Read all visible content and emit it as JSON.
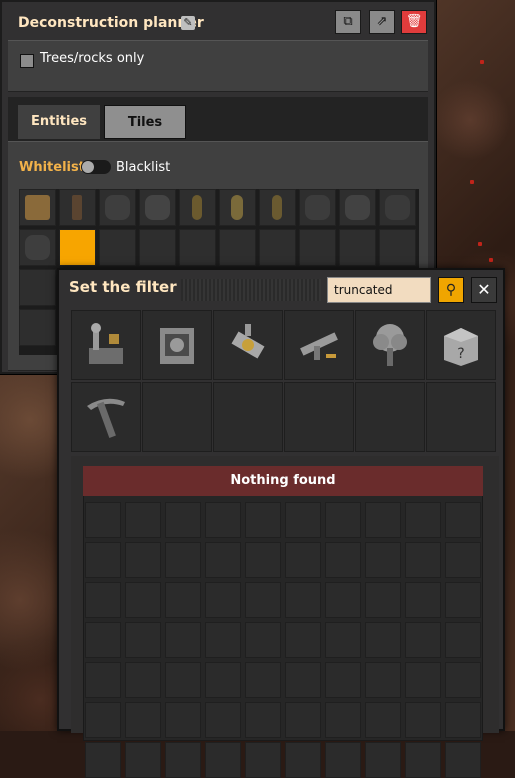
{
  "planner": {
    "title": "Deconstruction planner",
    "icons": {
      "rename": "pencil-icon",
      "copy": "copy-icon",
      "export": "export-icon",
      "delete": "trash-icon"
    },
    "trees_rocks_label": "Trees/rocks only",
    "tabs": [
      {
        "label": "Entities",
        "active": true
      },
      {
        "label": "Tiles",
        "active": false
      }
    ],
    "whitelist_label": "Whitelist",
    "blacklist_label": "Blacklist"
  },
  "filter_dialog": {
    "title": "Set the filter",
    "search_value": "truncated",
    "search_icon": "magnifier-icon",
    "close_icon": "close-icon",
    "groups": [
      "logistics",
      "production",
      "intermediate products",
      "combat",
      "environment",
      "unsorted",
      "other"
    ],
    "nothing_found": "Nothing found"
  },
  "colors": {
    "accent": "#f7a500",
    "title": "#ffe6c0",
    "danger": "#e03c3c",
    "banner": "#6a2c2c"
  }
}
